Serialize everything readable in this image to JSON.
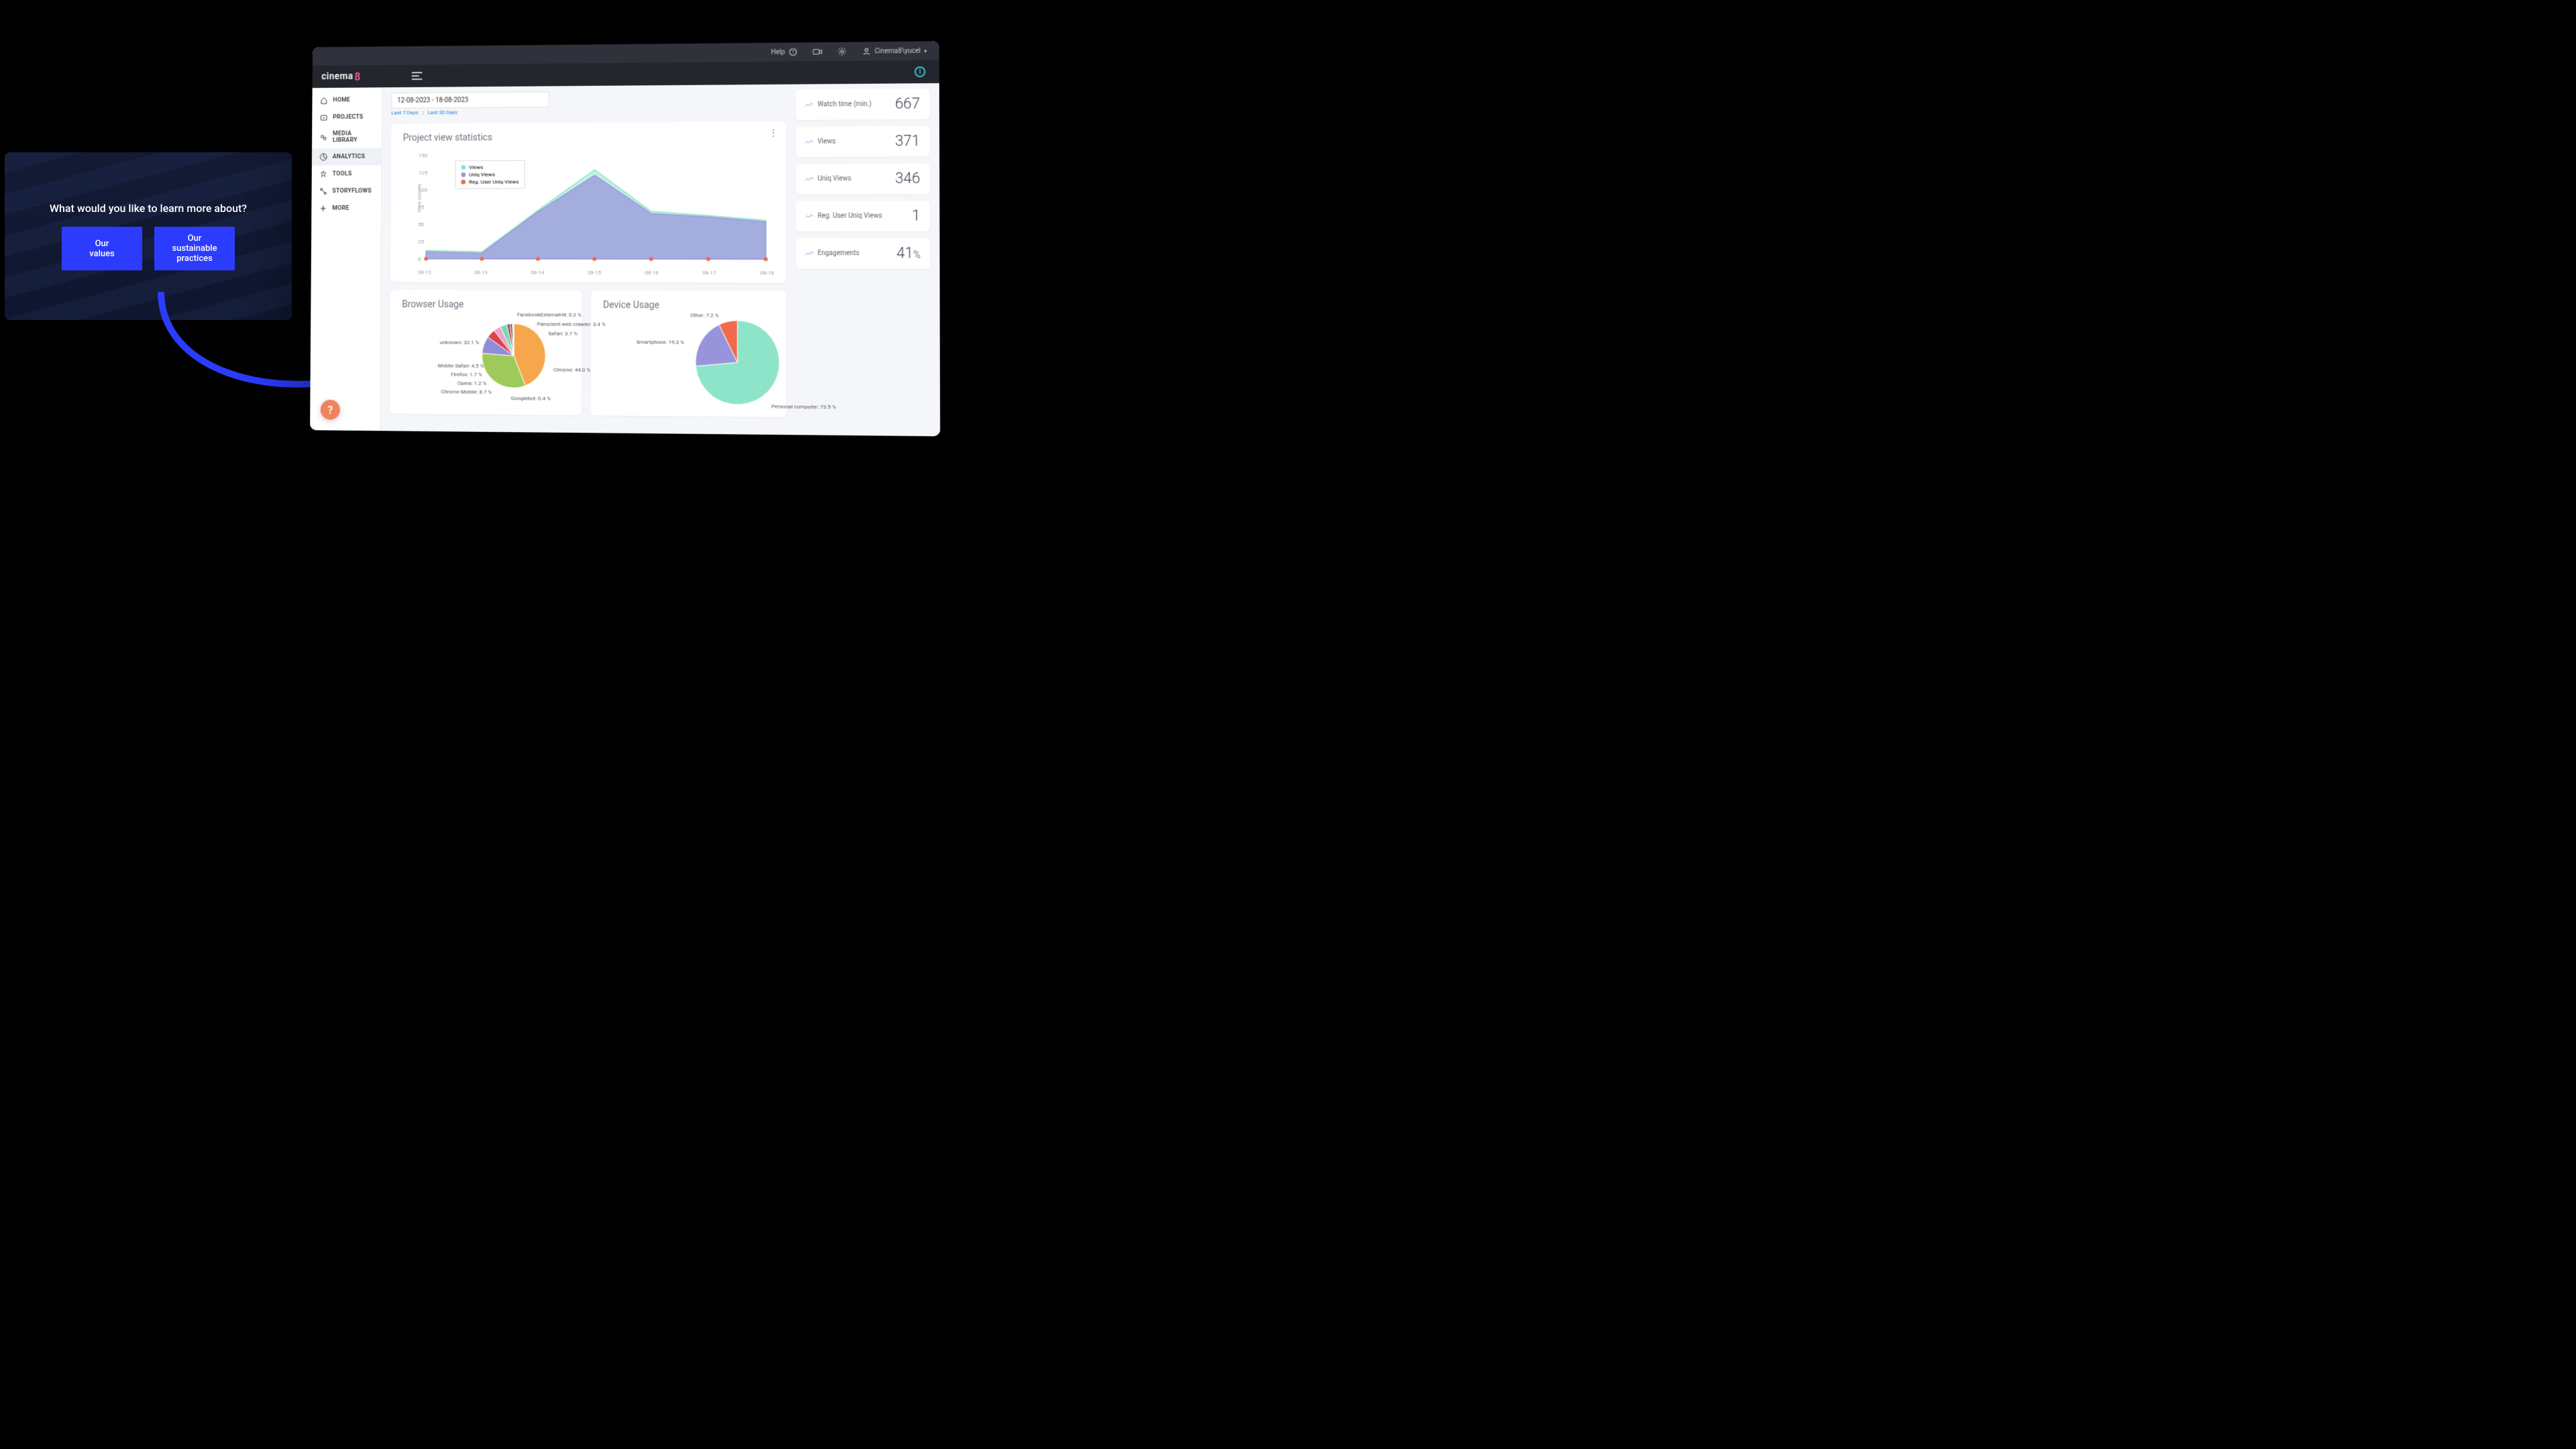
{
  "promo": {
    "question": "What would you like to learn more about?",
    "btn_values": "Our\nvalues",
    "btn_practices": "Our sustainable\npractices"
  },
  "topbar": {
    "help": "Help",
    "user": "Cinema8\\yucel"
  },
  "brand": "cinema",
  "sidebar": {
    "items": [
      {
        "label": "HOME"
      },
      {
        "label": "PROJECTS"
      },
      {
        "label": "MEDIA LIBRARY"
      },
      {
        "label": "ANALYTICS"
      },
      {
        "label": "TOOLS"
      },
      {
        "label": "STORYFLOWS"
      },
      {
        "label": "MORE"
      }
    ]
  },
  "date_range": "12-08-2023 - 18-08-2023",
  "quick_links": {
    "last7": "Last 7 Days",
    "last30": "Last 30 Days"
  },
  "chart_card_title": "Project view statistics",
  "y_axis_label": "View counts",
  "legend": {
    "views": "Views",
    "uniq": "Uniq Views",
    "reg": "Reg. User Uniq Views"
  },
  "browser_title": "Browser Usage",
  "device_title": "Device Usage",
  "metrics": {
    "watch": {
      "label": "Watch time (min.)",
      "value": "667"
    },
    "views": {
      "label": "Views",
      "value": "371"
    },
    "uniq": {
      "label": "Uniq Views",
      "value": "346"
    },
    "reg": {
      "label": "Reg. User Uniq Views",
      "value": "1"
    },
    "eng": {
      "label": "Engagements",
      "value": "41",
      "suffix": "%"
    }
  },
  "help_fab": "?",
  "chart_data": {
    "project_views": {
      "type": "area",
      "x": [
        "08-12",
        "08-13",
        "08-14",
        "08-15",
        "08-16",
        "08-17",
        "08-18"
      ],
      "ylim": [
        0,
        150
      ],
      "yticks": [
        0,
        25,
        50,
        75,
        100,
        125,
        150
      ],
      "series": [
        {
          "name": "Views",
          "color": "#8ae4c8",
          "values": [
            12,
            10,
            70,
            128,
            68,
            62,
            55
          ]
        },
        {
          "name": "Uniq Views",
          "color": "#9a97dc",
          "values": [
            10,
            8,
            68,
            120,
            65,
            60,
            53
          ]
        },
        {
          "name": "Reg. User Uniq Views",
          "color": "#f06a4d",
          "values": [
            0,
            0,
            0,
            0,
            0,
            0,
            1
          ]
        }
      ]
    },
    "browser_usage": {
      "type": "pie",
      "slices": [
        {
          "label": "Chrome",
          "pct": 44.0,
          "color": "#f6a74c"
        },
        {
          "label": "unknown",
          "pct": 32.1,
          "color": "#9dca5a"
        },
        {
          "label": "Chrome Mobile",
          "pct": 8.7,
          "color": "#8f8cd8"
        },
        {
          "label": "Mobile Safari",
          "pct": 4.5,
          "color": "#d8444a"
        },
        {
          "label": "Safari",
          "pct": 3.7,
          "color": "#f49fc4"
        },
        {
          "label": "Panscient web crawler",
          "pct": 3.4,
          "color": "#6ddcb5"
        },
        {
          "label": "Firefox",
          "pct": 1.7,
          "color": "#b54a4a"
        },
        {
          "label": "Opera",
          "pct": 1.2,
          "color": "#4a567a"
        },
        {
          "label": "Googlebot",
          "pct": 0.4,
          "color": "#e8cf7a"
        },
        {
          "label": "FacebookExternalHit",
          "pct": 0.2,
          "color": "#8acde0"
        }
      ]
    },
    "device_usage": {
      "type": "pie",
      "slices": [
        {
          "label": "Personal computer",
          "pct": 73.5,
          "color": "#8ee4c8"
        },
        {
          "label": "Smartphone",
          "pct": 19.3,
          "color": "#9894dc"
        },
        {
          "label": "Other",
          "pct": 7.2,
          "color": "#f06a4d"
        }
      ]
    }
  }
}
